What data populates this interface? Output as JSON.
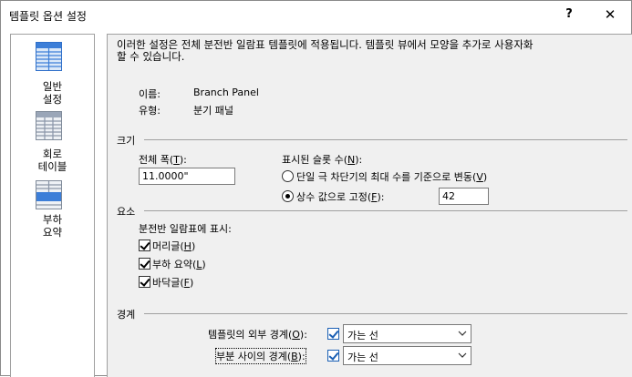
{
  "window": {
    "title": "템플릿 옵션 설정",
    "help": "?",
    "close": "✕"
  },
  "sidebar": {
    "items": [
      {
        "label": "일반\n설정",
        "icon": "grid-blue-icon",
        "color": "#3c7ed8"
      },
      {
        "label": "회로\n테이블",
        "icon": "grid-gray-icon",
        "color": "#9aa6b8"
      },
      {
        "label": "부하\n요약",
        "icon": "grid-summary-icon",
        "color": "#9aa6b8"
      }
    ]
  },
  "main": {
    "description": "이러한 설정은 전체 분전반 일람표 템플릿에 적용됩니다. 템플릿 뷰에서 모양을 추가로 사용자화\n할 수 있습니다.",
    "info": {
      "name_label": "이름:",
      "name_value": "Branch Panel",
      "type_label": "유형:",
      "type_value": "분기 패널"
    },
    "size": {
      "header": "크기",
      "total_width_label_pre": "전체 폭(",
      "total_width_hotkey": "T",
      "total_width_label_post": "):",
      "total_width_value": "11.0000\"",
      "slots_label_pre": "표시된 슬롯 수(",
      "slots_hotkey": "N",
      "slots_label_post": "):",
      "radio_variable_pre": "단일 극 차단기의 최대 수를 기준으로 변동(",
      "radio_variable_hotkey": "V",
      "radio_variable_post": ")",
      "radio_fixed_pre": "상수 값으로 고정(",
      "radio_fixed_hotkey": "F",
      "radio_fixed_post": "):",
      "fixed_value": "42",
      "selected": "fixed"
    },
    "elements": {
      "header": "요소",
      "show_label": "분전반 일람표에 표시:",
      "checkboxes": [
        {
          "pre": "머리글(",
          "hotkey": "H",
          "post": ")",
          "checked": true
        },
        {
          "pre": "부하 요약(",
          "hotkey": "L",
          "post": ")",
          "checked": true
        },
        {
          "pre": "바닥글(",
          "hotkey": "F",
          "post": ")",
          "checked": true
        }
      ]
    },
    "borders": {
      "header": "경계",
      "outer_pre": "템플릿의 외부 경계(",
      "outer_hotkey": "O",
      "outer_post": "):",
      "outer_checked": true,
      "outer_value": "가는 선",
      "section_pre": "부분 사이의 경계(",
      "section_hotkey": "B",
      "section_post": "):",
      "section_checked": true,
      "section_value": "가는 선"
    }
  }
}
